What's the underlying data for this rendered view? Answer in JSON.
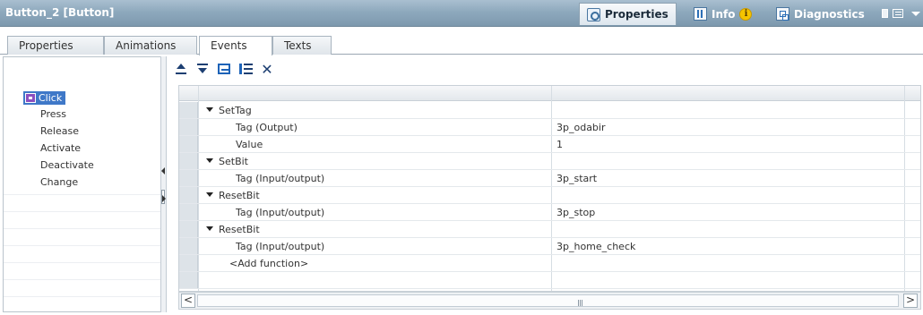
{
  "window": {
    "title": "Button_2 [Button]"
  },
  "panel_tabs": [
    {
      "label": "Properties",
      "icon": "properties-icon",
      "active": true
    },
    {
      "label": "Info",
      "icon": "info-icon",
      "active": false
    },
    {
      "label": "Diagnostics",
      "icon": "diagnostics-icon",
      "active": false
    }
  ],
  "main_tabs": [
    "Properties",
    "Animations",
    "Events",
    "Texts"
  ],
  "events": [
    "Click",
    "Press",
    "Release",
    "Activate",
    "Deactivate",
    "Change"
  ],
  "toolbar": {
    "move_up": "move-up-icon",
    "move_down": "move-down-icon",
    "insert_line": "insert-line-icon",
    "list": "list-icon",
    "delete": "✕"
  },
  "grid": {
    "rows": [
      {
        "name": "SetTag",
        "value": "",
        "group": true
      },
      {
        "name": "Tag (Output)",
        "value": "3p_odabir",
        "group": false
      },
      {
        "name": "Value",
        "value": "1",
        "group": false
      },
      {
        "name": "SetBit",
        "value": "",
        "group": true
      },
      {
        "name": "Tag (Input/output)",
        "value": "3p_start",
        "group": false
      },
      {
        "name": "ResetBit",
        "value": "",
        "group": true
      },
      {
        "name": "Tag (Input/output)",
        "value": "3p_stop",
        "group": false
      },
      {
        "name": "ResetBit",
        "value": "",
        "group": true
      },
      {
        "name": "Tag (Input/output)",
        "value": "3p_home_check",
        "group": false
      },
      {
        "name": "<Add function>",
        "value": "",
        "group": false
      }
    ]
  },
  "scroll": {
    "left": "<",
    "right": ">"
  },
  "colors": {
    "selection": "#3f78c8",
    "titlebar": "#8ea9bd"
  }
}
